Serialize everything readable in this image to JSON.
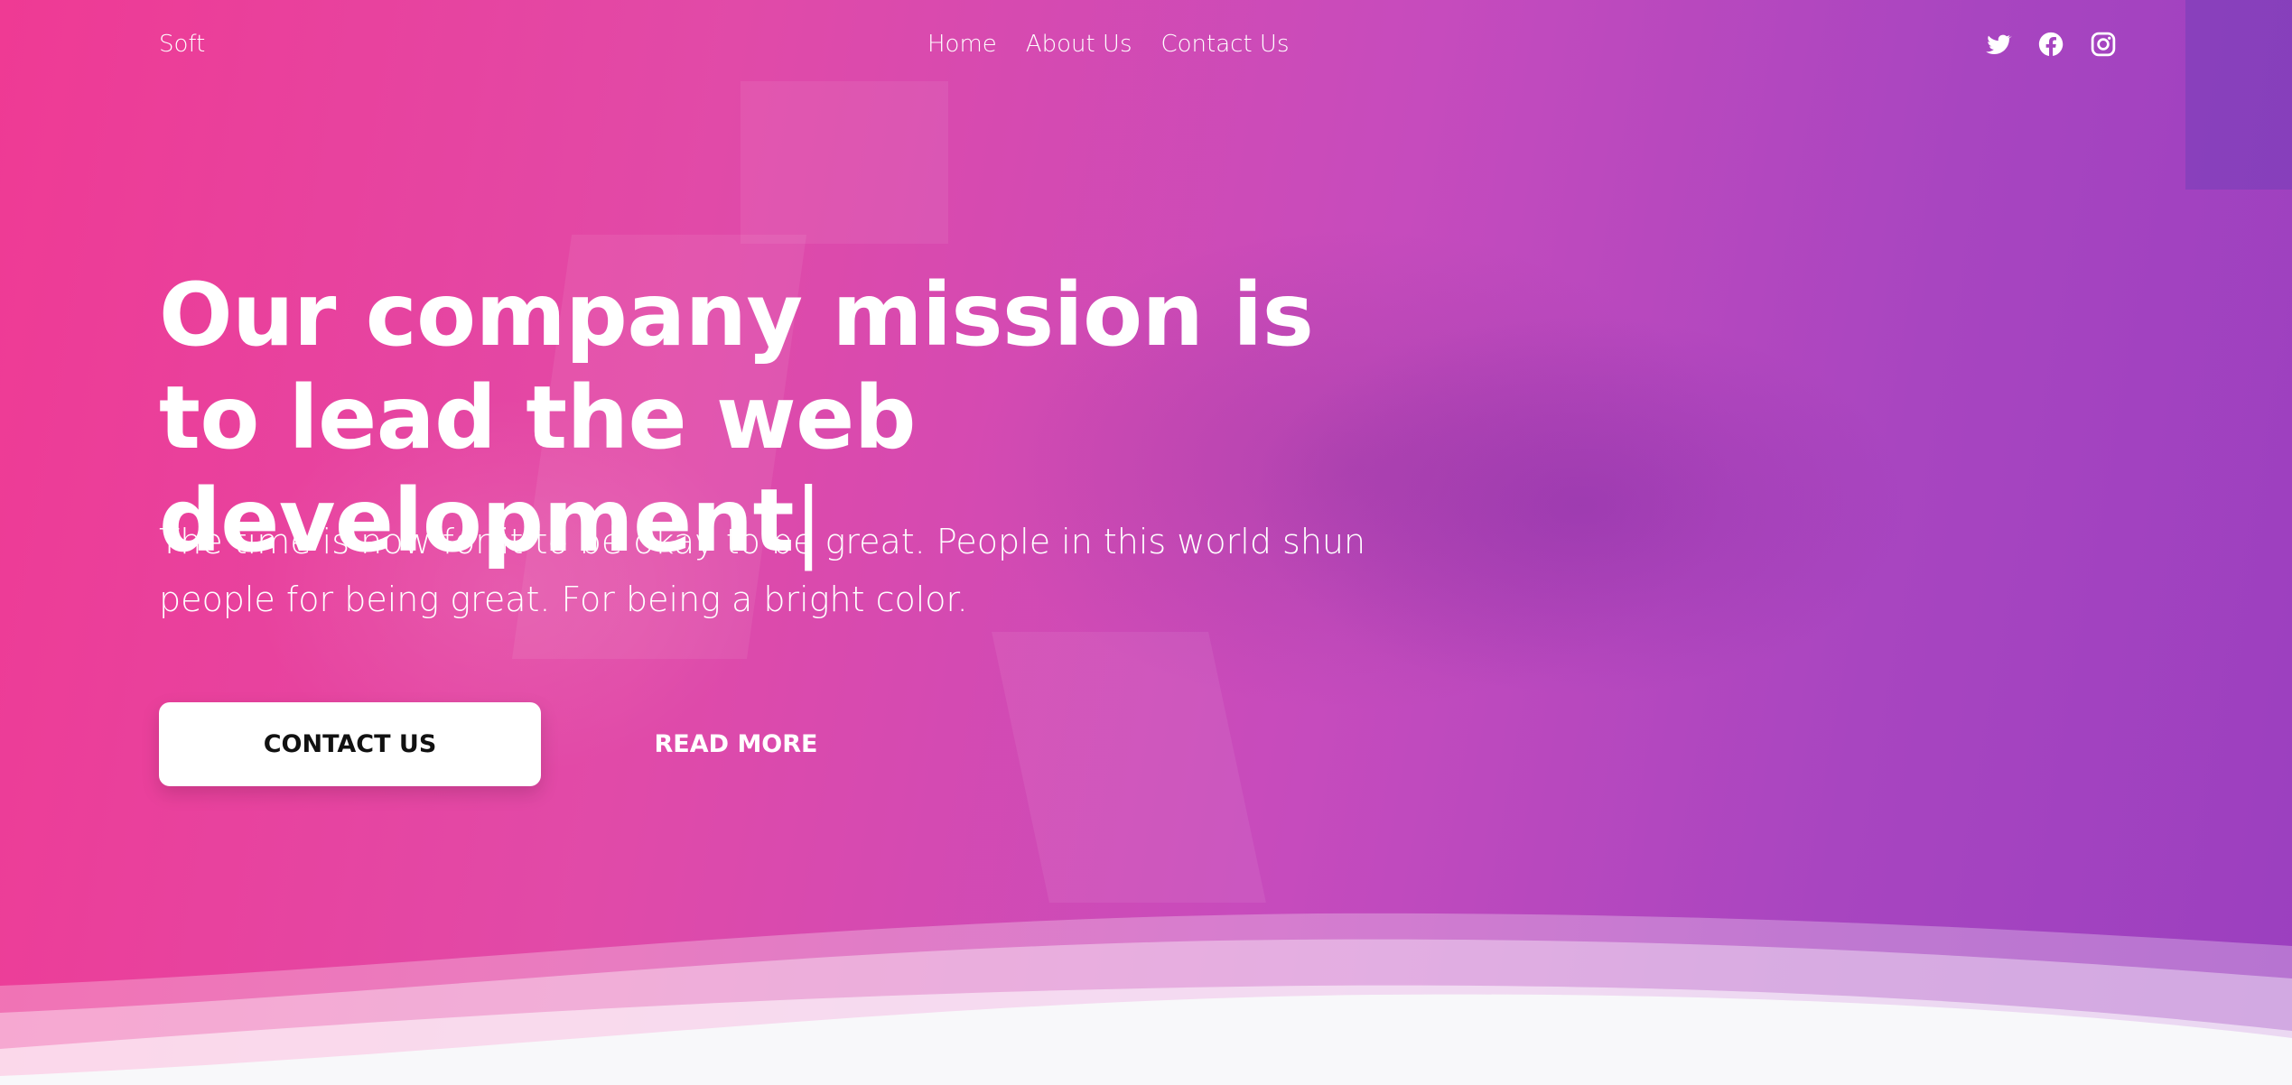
{
  "nav": {
    "brand": "Soft",
    "links": [
      "Home",
      "About Us",
      "Contact Us"
    ]
  },
  "social": {
    "icons": [
      "twitter-icon",
      "facebook-icon",
      "instagram-icon"
    ]
  },
  "hero": {
    "headline": "Our company mission is to lead the web development",
    "caret": "|",
    "lead": "The time is now for it to be okay to be great. People in this world shun people for being great. For being a bright color.",
    "primary_cta": "CONTACT US",
    "secondary_cta": "READ MORE"
  },
  "colors": {
    "gradient_start": "#ef3a94",
    "gradient_end": "#9b3fbf",
    "wave_bottom": "#f8f8fa"
  }
}
